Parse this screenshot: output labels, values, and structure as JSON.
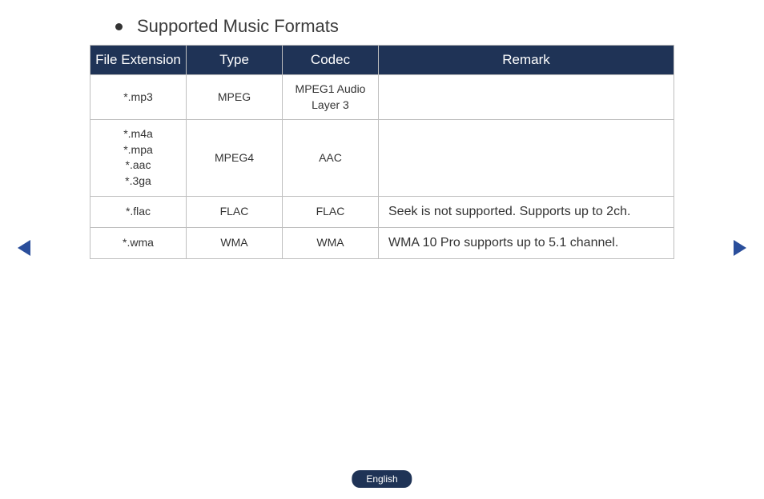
{
  "heading": "Supported Music Formats",
  "columns": {
    "ext": "File Extension",
    "type": "Type",
    "codec": "Codec",
    "remark": "Remark"
  },
  "rows": [
    {
      "ext": [
        "*.mp3"
      ],
      "type": "MPEG",
      "codec": "MPEG1 Audio Layer 3",
      "remark": ""
    },
    {
      "ext": [
        "*.m4a",
        "*.mpa",
        "*.aac",
        "*.3ga"
      ],
      "type": "MPEG4",
      "codec": "AAC",
      "remark": ""
    },
    {
      "ext": [
        "*.flac"
      ],
      "type": "FLAC",
      "codec": "FLAC",
      "remark": "Seek is not supported. Supports up to 2ch."
    },
    {
      "ext": [
        "*.wma"
      ],
      "type": "WMA",
      "codec": "WMA",
      "remark": "WMA 10 Pro supports up to 5.1 channel."
    }
  ],
  "language": "English"
}
